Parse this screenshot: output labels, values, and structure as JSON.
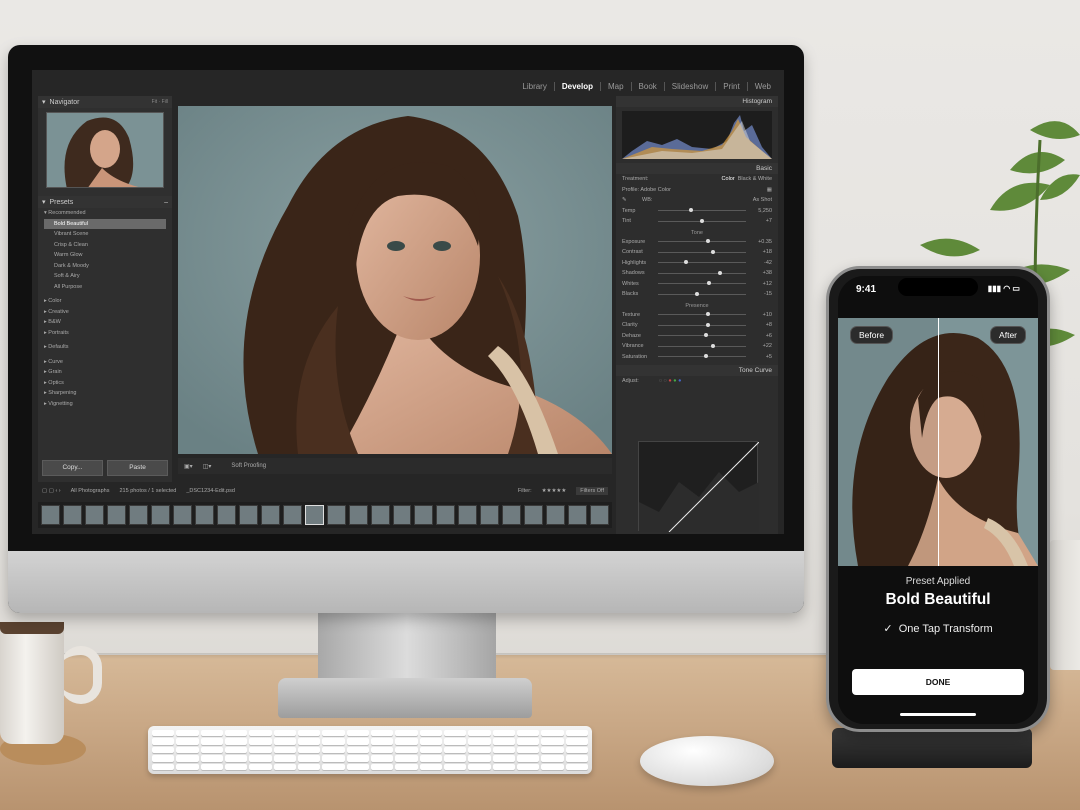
{
  "lightroom": {
    "modules": [
      "Library",
      "Develop",
      "Map",
      "Book",
      "Slideshow",
      "Print",
      "Web"
    ],
    "active_module": "Develop",
    "navigator": {
      "title": "Navigator",
      "zoom": "Fit · Fill"
    },
    "presets": {
      "title": "Presets",
      "group": "Recommended",
      "items": [
        "Bold Beautiful",
        "Vibrant Scene",
        "Crisp & Clean",
        "Warm Glow",
        "Dark & Moody",
        "Soft & Airy",
        "All Purpose"
      ],
      "selected": "Bold Beautiful",
      "groups": [
        "Color",
        "Creative",
        "B&W",
        "Portraits"
      ],
      "defaults": "Defaults",
      "groups2": [
        "Curve",
        "Grain",
        "Optics",
        "Sharpening",
        "Vignetting"
      ]
    },
    "buttons": {
      "copy": "Copy...",
      "paste": "Paste"
    },
    "toolbar": {
      "soft_proofing": "Soft Proofing"
    },
    "filmstrip": {
      "source": "All Photographs",
      "count": "215 photos / 1 selected",
      "file": "_DSC1234-Edit.psd",
      "filter": "Filter:",
      "filters_off": "Filters Off"
    },
    "right": {
      "histogram": "Histogram",
      "basic": "Basic",
      "treatment_label": "Treatment:",
      "treatment_color": "Color",
      "treatment_bw": "Black & White",
      "profile": "Profile: Adobe Color",
      "wb_label": "WB:",
      "wb_value": "As Shot",
      "wb": [
        {
          "label": "Temp",
          "value": "5,250",
          "pos": 0.35
        },
        {
          "label": "Tint",
          "value": "+7",
          "pos": 0.48
        }
      ],
      "tone_title": "Tone",
      "tone": [
        {
          "label": "Exposure",
          "value": "+0.35",
          "pos": 0.55
        },
        {
          "label": "Contrast",
          "value": "+18",
          "pos": 0.6
        },
        {
          "label": "Highlights",
          "value": "-42",
          "pos": 0.3
        },
        {
          "label": "Shadows",
          "value": "+38",
          "pos": 0.68
        },
        {
          "label": "Whites",
          "value": "+12",
          "pos": 0.56
        },
        {
          "label": "Blacks",
          "value": "-15",
          "pos": 0.42
        }
      ],
      "presence_title": "Presence",
      "presence": [
        {
          "label": "Texture",
          "value": "+10",
          "pos": 0.55
        },
        {
          "label": "Clarity",
          "value": "+8",
          "pos": 0.54
        },
        {
          "label": "Dehaze",
          "value": "+6",
          "pos": 0.52
        },
        {
          "label": "Vibrance",
          "value": "+22",
          "pos": 0.6
        },
        {
          "label": "Saturation",
          "value": "+5",
          "pos": 0.52
        }
      ],
      "tone_curve": "Tone Curve",
      "adjust": "Adjust:"
    }
  },
  "phone": {
    "time": "9:41",
    "before": "Before",
    "after": "After",
    "applied": "Preset Applied",
    "preset_name": "Bold Beautiful",
    "tagline": "One Tap Transform",
    "done": "DONE"
  },
  "colors": {
    "accent": "#ffffff",
    "lr_panel": "#2f2f2f",
    "desk": "#c9a886"
  }
}
